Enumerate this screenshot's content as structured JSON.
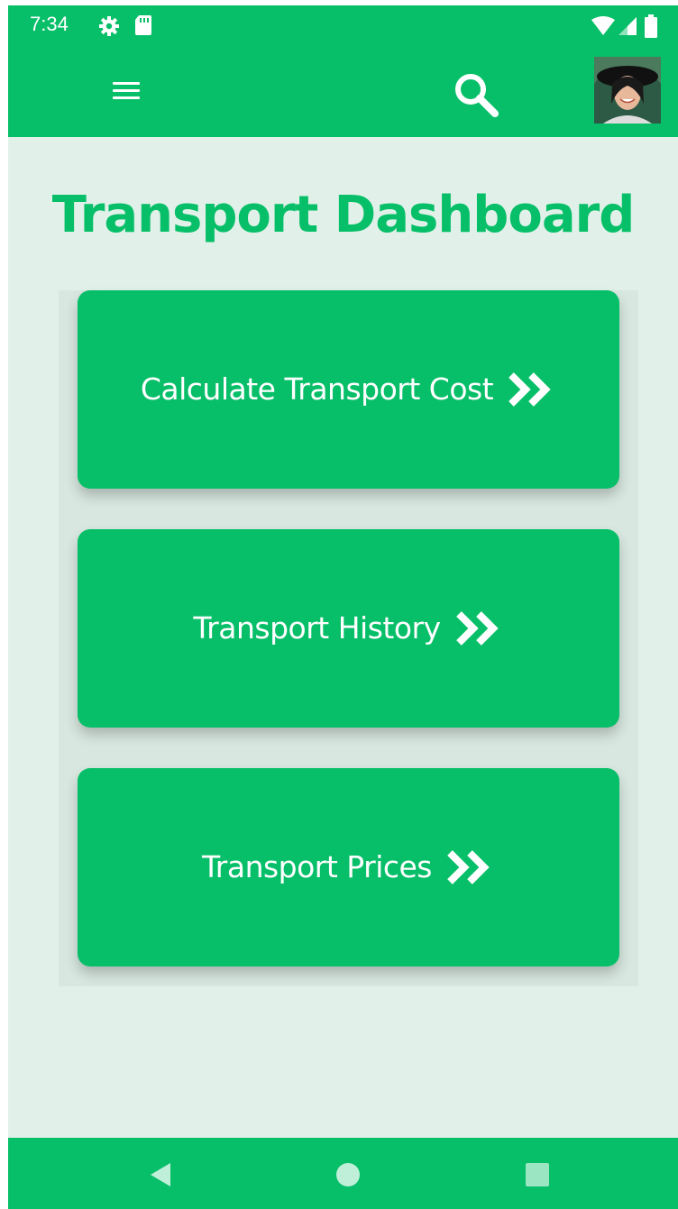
{
  "status_bar": {
    "time": "7:34",
    "left_icons": [
      "gear-icon",
      "sd-card-icon"
    ],
    "right_icons": [
      "wifi-icon",
      "cell-signal-icon",
      "battery-icon"
    ]
  },
  "toolbar": {
    "menu_icon": "hamburger-menu-icon",
    "search_icon": "search-icon",
    "avatar": "user-avatar-photo"
  },
  "main": {
    "title": "Transport Dashboard",
    "cards": [
      {
        "label": "Calculate Transport Cost",
        "icon": "double-chevron-right-icon"
      },
      {
        "label": "Transport History",
        "icon": "double-chevron-right-icon"
      },
      {
        "label": "Transport Prices",
        "icon": "double-chevron-right-icon"
      }
    ]
  },
  "nav_bar": {
    "buttons": [
      "back-triangle-icon",
      "home-circle-icon",
      "recents-square-icon"
    ]
  },
  "colors": {
    "primary": "#07bf68",
    "background": "#e1f1e9",
    "panel": "#d8e8e0",
    "text_on_primary": "#ffffff"
  }
}
